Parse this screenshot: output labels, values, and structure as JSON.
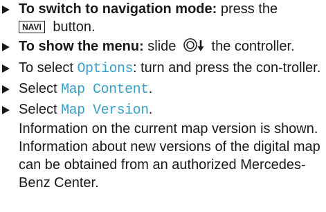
{
  "steps": [
    {
      "lead": "To switch to navigation mode:",
      "text_before": " press the",
      "key_label": "NAVI",
      "text_after": " button."
    },
    {
      "lead": "To show the menu:",
      "text_before": " slide",
      "control_icon": "controller-slide-down-icon",
      "text_after": " the controller."
    },
    {
      "text_before": "To select ",
      "mono": "Options",
      "text_after": ": turn and press the con-troller."
    },
    {
      "text_before": "Select ",
      "mono": "Map Content",
      "text_after": "."
    },
    {
      "text_before": "Select ",
      "mono": "Map Version",
      "text_after": ".",
      "result": "Information on the current map version is shown. Information about new versions of the digital map can be obtained from an authorized Mercedes-Benz Center."
    }
  ],
  "colors": {
    "text": "#1a1a1a",
    "mono_accent": "#3aa0c8"
  }
}
